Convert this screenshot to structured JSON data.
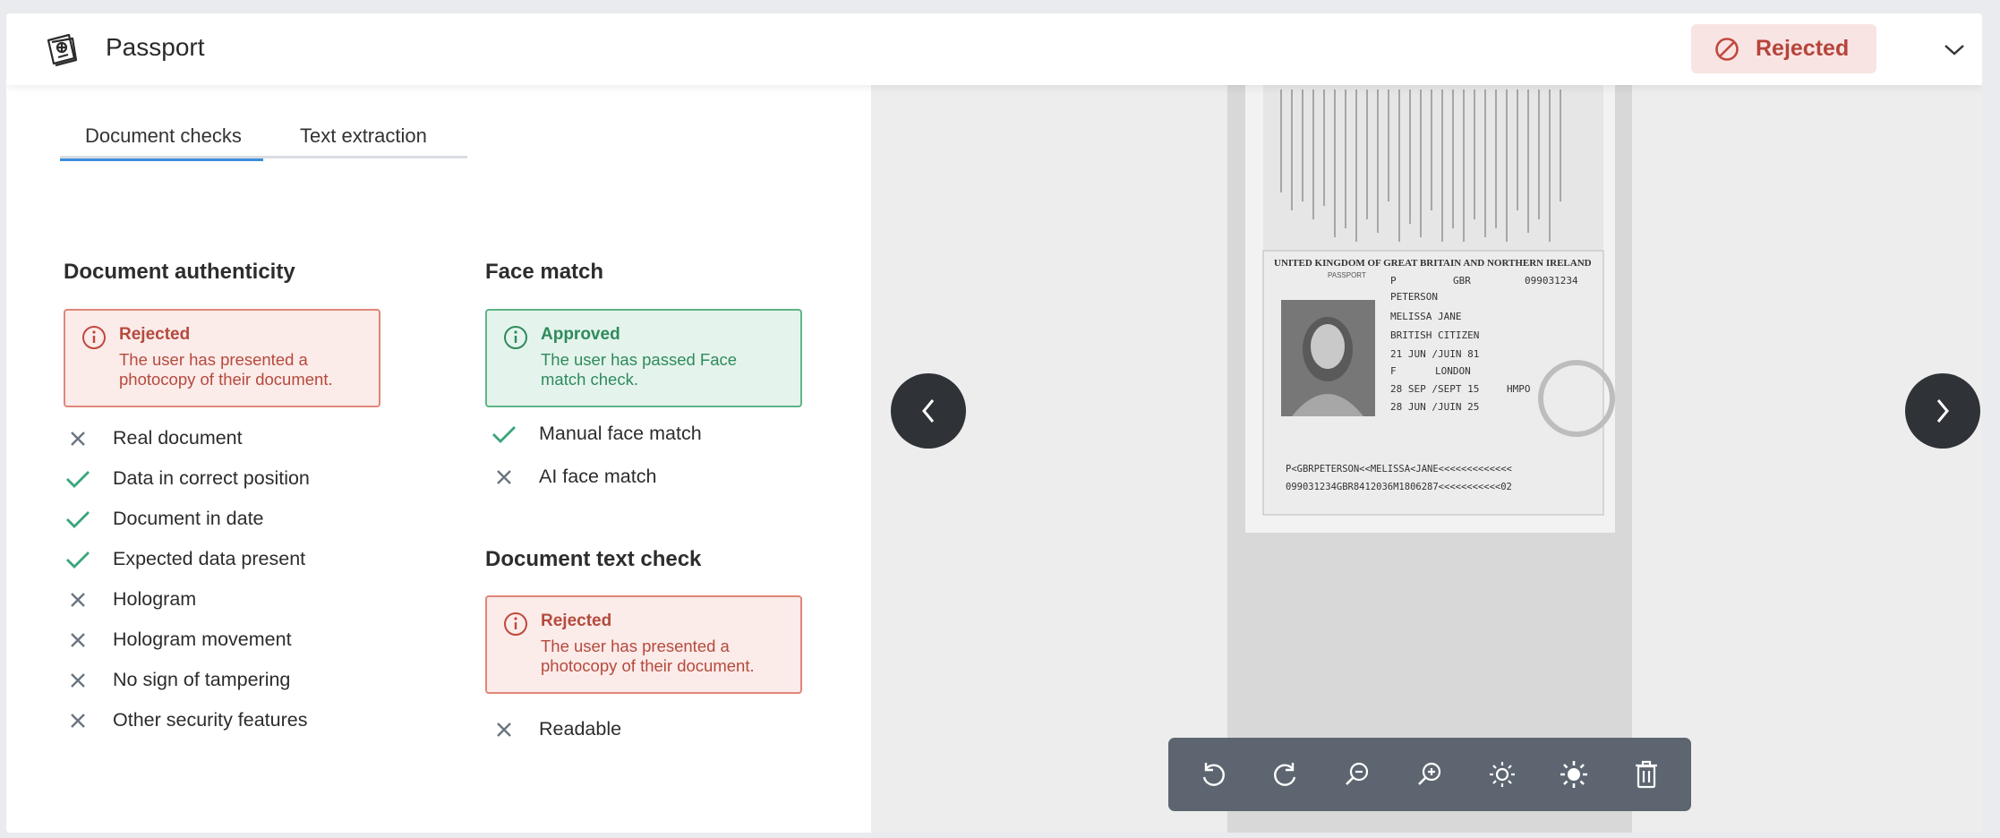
{
  "header": {
    "title": "Passport",
    "icon": "passport-icon",
    "status_label": "Rejected",
    "status_icon": "prohibited-icon",
    "collapse_icon": "chevron-down-icon"
  },
  "tabs": [
    {
      "label": "Document checks",
      "active": true
    },
    {
      "label": "Text extraction",
      "active": false
    }
  ],
  "document_authenticity": {
    "title": "Document authenticity",
    "alert": {
      "status": "Rejected",
      "message": "The user has presented a photocopy of their document."
    },
    "checks": [
      {
        "label": "Real document",
        "passed": false
      },
      {
        "label": "Data in correct position",
        "passed": true
      },
      {
        "label": "Document in date",
        "passed": true
      },
      {
        "label": "Expected data present",
        "passed": true
      },
      {
        "label": "Hologram",
        "passed": false
      },
      {
        "label": "Hologram movement",
        "passed": false
      },
      {
        "label": "No sign of tampering",
        "passed": false
      },
      {
        "label": "Other security features",
        "passed": false
      }
    ]
  },
  "face_match": {
    "title": "Face match",
    "alert": {
      "status": "Approved",
      "message": "The user has passed Face match check."
    },
    "checks": [
      {
        "label": "Manual face match",
        "passed": true
      },
      {
        "label": "AI face match",
        "passed": false
      }
    ]
  },
  "document_text_check": {
    "title": "Document text check",
    "alert": {
      "status": "Rejected",
      "message": "The user has presented a photocopy of their document."
    },
    "checks": [
      {
        "label": "Readable",
        "passed": false
      }
    ]
  },
  "viewer": {
    "passport_text": {
      "country": "UNITED KINGDOM OF GREAT BRITAIN AND NORTHERN IRELAND",
      "doc_label": "PASSPORT",
      "type": "P",
      "code": "GBR",
      "number": "099031234",
      "surname": "PETERSON",
      "given_names": "MELISSA JANE",
      "nationality": "BRITISH CITIZEN",
      "dob": "21 JUN /JUIN 81",
      "sex": "F",
      "pob": "LONDON",
      "issue_date": "28 SEP /SEPT 15",
      "authority": "HMPO",
      "expiry_date": "28 JUN /JUIN 25",
      "mrz1": "P<GBRPETERSON<<MELISSA<JANE<<<<<<<<<<<<<",
      "mrz2": "099031234GBR8412036M1806287<<<<<<<<<<<02"
    },
    "prev_icon": "chevron-left-icon",
    "next_icon": "chevron-right-icon",
    "tools": [
      "rotate-left-icon",
      "rotate-right-icon",
      "zoom-out-icon",
      "zoom-in-icon",
      "brightness-low-icon",
      "brightness-high-icon",
      "trash-icon"
    ]
  },
  "colors": {
    "rejected": "#b6443b",
    "approved": "#2f8a5c",
    "accent": "#3b8fde",
    "pass_check": "#3aa57a",
    "fail_check": "#6b7480"
  }
}
